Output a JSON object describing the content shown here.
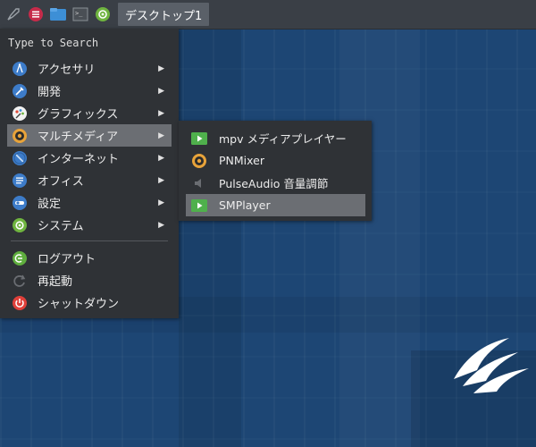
{
  "taskbar": {
    "icons": [
      "rocket-icon",
      "menu-icon",
      "folder-icon",
      "terminal-icon",
      "settings-icon"
    ],
    "workspace_label": "デスクトップ1"
  },
  "menu": {
    "search_placeholder": "Type to Search",
    "items": [
      {
        "label": "アクセサリ",
        "icon": "accessories-icon",
        "submenu": true
      },
      {
        "label": "開発",
        "icon": "development-icon",
        "submenu": true
      },
      {
        "label": "グラフィックス",
        "icon": "graphics-icon",
        "submenu": true
      },
      {
        "label": "マルチメディア",
        "icon": "multimedia-icon",
        "submenu": true,
        "active": true
      },
      {
        "label": "インターネット",
        "icon": "internet-icon",
        "submenu": true
      },
      {
        "label": "オフィス",
        "icon": "office-icon",
        "submenu": true
      },
      {
        "label": "設定",
        "icon": "settings-icon",
        "submenu": true
      },
      {
        "label": "システム",
        "icon": "system-icon",
        "submenu": true
      }
    ],
    "session": [
      {
        "label": "ログアウト",
        "icon": "logout-icon"
      },
      {
        "label": "再起動",
        "icon": "restart-icon"
      },
      {
        "label": "シャットダウン",
        "icon": "shutdown-icon"
      }
    ],
    "arrow": "▶"
  },
  "submenu": {
    "items": [
      {
        "label": "mpv メディアプレイヤー",
        "icon": "mpv-icon"
      },
      {
        "label": "PNMixer",
        "icon": "pnmixer-icon"
      },
      {
        "label": "PulseAudio 音量調節",
        "icon": "speaker-icon"
      },
      {
        "label": "SMPlayer",
        "icon": "smplayer-icon",
        "active": true
      }
    ]
  },
  "colors": {
    "desktop": "#1d4674",
    "taskbar": "#3a3f46",
    "menu_bg": "#2f3236",
    "highlight": "#6b6e73"
  }
}
